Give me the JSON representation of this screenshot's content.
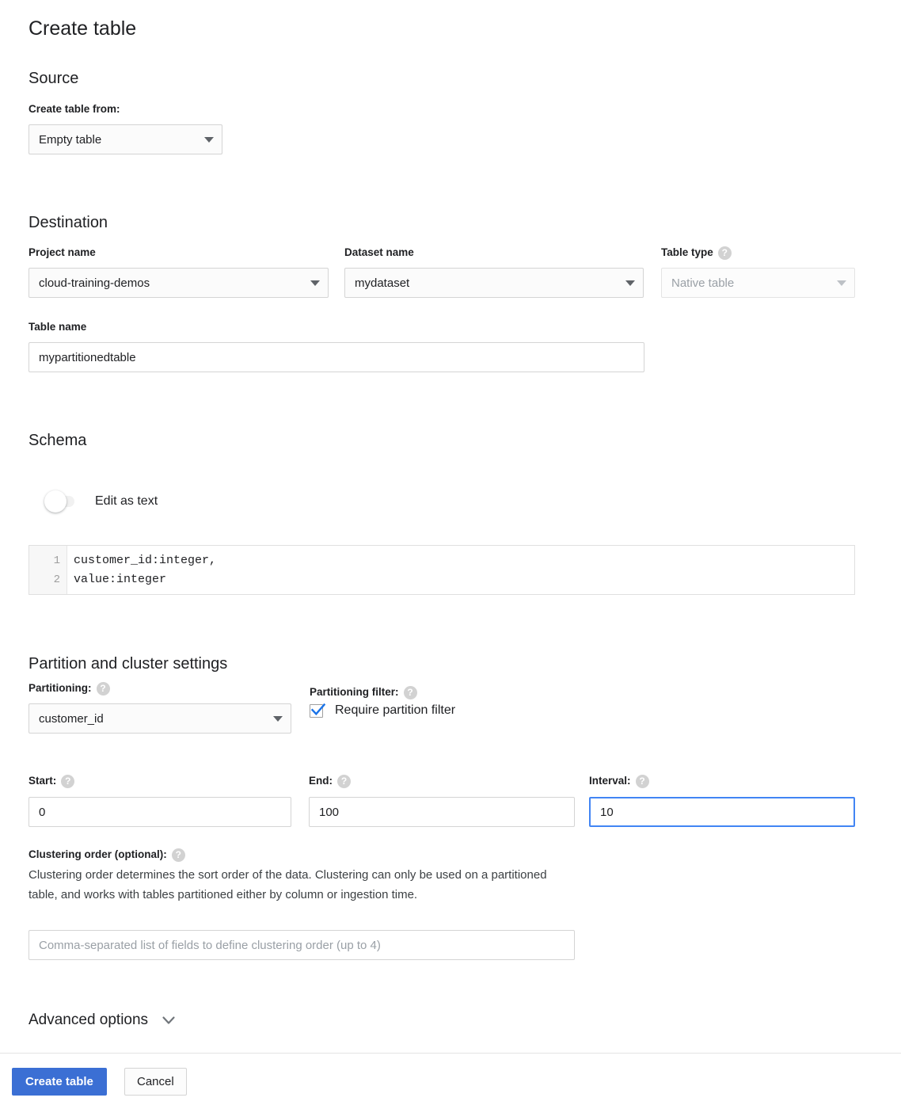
{
  "dialog": {
    "title": "Create table"
  },
  "source": {
    "heading": "Source",
    "create_from_label": "Create table from:",
    "create_from_value": "Empty table"
  },
  "destination": {
    "heading": "Destination",
    "project_label": "Project name",
    "project_value": "cloud-training-demos",
    "dataset_label": "Dataset name",
    "dataset_value": "mydataset",
    "table_type_label": "Table type",
    "table_type_value": "Native table",
    "table_name_label": "Table name",
    "table_name_value": "mypartitionedtable"
  },
  "schema": {
    "heading": "Schema",
    "edit_as_text_label": "Edit as text",
    "edit_as_text_on": false,
    "lines": [
      {
        "number": "1",
        "text": "customer_id:integer,"
      },
      {
        "number": "2",
        "text": "value:integer"
      }
    ]
  },
  "partition": {
    "heading": "Partition and cluster settings",
    "partitioning_label": "Partitioning:",
    "partitioning_value": "customer_id",
    "partition_filter_label": "Partitioning filter:",
    "require_filter_label": "Require partition filter",
    "require_filter_checked": true,
    "start_label": "Start:",
    "start_value": "0",
    "end_label": "End:",
    "end_value": "100",
    "interval_label": "Interval:",
    "interval_value": "10",
    "clustering_label": "Clustering order (optional):",
    "clustering_description": "Clustering order determines the sort order of the data. Clustering can only be used on a partitioned table, and works with tables partitioned either by column or ingestion time.",
    "clustering_placeholder": "Comma-separated list of fields to define clustering order (up to 4)"
  },
  "advanced": {
    "label": "Advanced options"
  },
  "footer": {
    "create_label": "Create table",
    "cancel_label": "Cancel"
  },
  "colors": {
    "primary_button": "#3b6fd4",
    "focus_border": "#4285f4",
    "checkmark": "#1a73e8",
    "help_icon": "#d2d2d2"
  }
}
